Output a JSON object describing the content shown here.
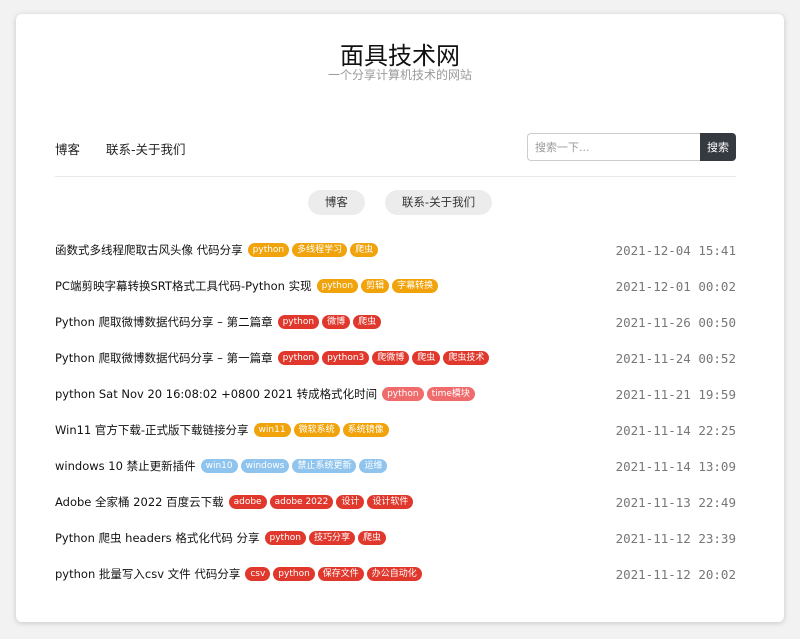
{
  "site": {
    "title": "面具技术网",
    "subtitle": "一个分享计算机技术的网站"
  },
  "nav": {
    "items": [
      {
        "label": "博客"
      },
      {
        "label": "联系-关于我们"
      }
    ]
  },
  "search": {
    "placeholder": "搜索一下...",
    "button_label": "搜索"
  },
  "pills": [
    {
      "label": "博客"
    },
    {
      "label": "联系-关于我们"
    }
  ],
  "colors": {
    "yellow": "#f0a30a",
    "red": "#e0382c",
    "pink": "#f06b6b",
    "blue": "#8fc4ee"
  },
  "posts": [
    {
      "title": "函数式多线程爬取古风头像 代码分享",
      "tags": [
        {
          "label": "python",
          "color": "#f0a30a"
        },
        {
          "label": "多线程学习",
          "color": "#f0a30a"
        },
        {
          "label": "爬虫",
          "color": "#f0a30a"
        }
      ],
      "date": "2021-12-04 15:41"
    },
    {
      "title": "PC端剪映字幕转换SRT格式工具代码-Python 实现",
      "tags": [
        {
          "label": "python",
          "color": "#f0a30a"
        },
        {
          "label": "剪辑",
          "color": "#f0a30a"
        },
        {
          "label": "字幕转换",
          "color": "#f0a30a"
        }
      ],
      "date": "2021-12-01 00:02"
    },
    {
      "title": "Python 爬取微博数据代码分享 – 第二篇章",
      "tags": [
        {
          "label": "python",
          "color": "#e0382c"
        },
        {
          "label": "微博",
          "color": "#e0382c"
        },
        {
          "label": "爬虫",
          "color": "#e0382c"
        }
      ],
      "date": "2021-11-26 00:50"
    },
    {
      "title": "Python 爬取微博数据代码分享 – 第一篇章",
      "tags": [
        {
          "label": "python",
          "color": "#e0382c"
        },
        {
          "label": "python3",
          "color": "#e0382c"
        },
        {
          "label": "爬微博",
          "color": "#e0382c"
        },
        {
          "label": "爬虫",
          "color": "#e0382c"
        },
        {
          "label": "爬虫技术",
          "color": "#e0382c"
        }
      ],
      "date": "2021-11-24 00:52"
    },
    {
      "title": "python Sat Nov 20 16:08:02 +0800 2021 转成格式化时间",
      "tags": [
        {
          "label": "python",
          "color": "#f06b6b"
        },
        {
          "label": "time模块",
          "color": "#f06b6b"
        }
      ],
      "date": "2021-11-21 19:59"
    },
    {
      "title": "Win11 官方下载-正式版下载链接分享",
      "tags": [
        {
          "label": "win11",
          "color": "#f0a30a"
        },
        {
          "label": "微软系统",
          "color": "#f0a30a"
        },
        {
          "label": "系统镜像",
          "color": "#f0a30a"
        }
      ],
      "date": "2021-11-14 22:25"
    },
    {
      "title": "windows 10 禁止更新插件",
      "tags": [
        {
          "label": "win10",
          "color": "#8fc4ee"
        },
        {
          "label": "windows",
          "color": "#8fc4ee"
        },
        {
          "label": "禁止系统更新",
          "color": "#8fc4ee"
        },
        {
          "label": "运维",
          "color": "#8fc4ee"
        }
      ],
      "date": "2021-11-14 13:09"
    },
    {
      "title": "Adobe 全家桶 2022 百度云下载",
      "tags": [
        {
          "label": "adobe",
          "color": "#e0382c"
        },
        {
          "label": "adobe 2022",
          "color": "#e0382c"
        },
        {
          "label": "设计",
          "color": "#e0382c"
        },
        {
          "label": "设计软件",
          "color": "#e0382c"
        }
      ],
      "date": "2021-11-13 22:49"
    },
    {
      "title": "Python 爬虫 headers 格式化代码 分享",
      "tags": [
        {
          "label": "python",
          "color": "#e0382c"
        },
        {
          "label": "技巧分享",
          "color": "#e0382c"
        },
        {
          "label": "爬虫",
          "color": "#e0382c"
        }
      ],
      "date": "2021-11-12 23:39"
    },
    {
      "title": "python 批量写入csv 文件 代码分享",
      "tags": [
        {
          "label": "csv",
          "color": "#e0382c"
        },
        {
          "label": "python",
          "color": "#e0382c"
        },
        {
          "label": "保存文件",
          "color": "#e0382c"
        },
        {
          "label": "办公自动化",
          "color": "#e0382c"
        }
      ],
      "date": "2021-11-12 20:02"
    }
  ]
}
